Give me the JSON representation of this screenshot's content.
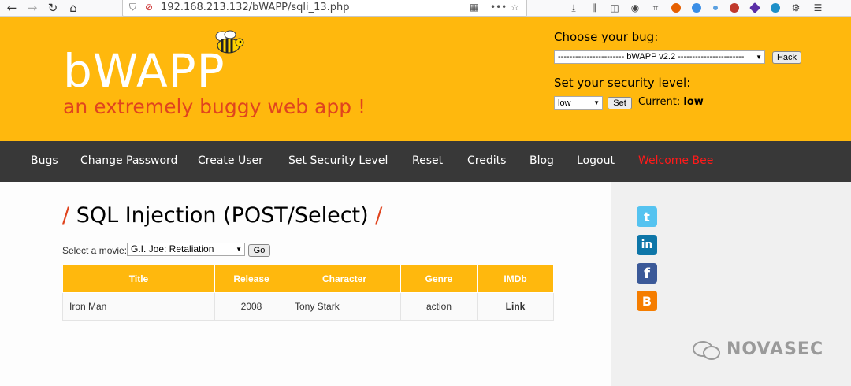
{
  "browser": {
    "url": "192.168.213.132/bWAPP/sqli_13.php"
  },
  "header": {
    "logo": "bWAPP",
    "tagline": "an extremely buggy web app !",
    "choose_bug_label": "Choose your bug:",
    "bug_select_value": "----------------------- bWAPP v2.2 -----------------------",
    "hack_button": "Hack",
    "security_label": "Set your security level:",
    "security_select_value": "low",
    "set_button": "Set",
    "current_label": "Current:",
    "current_value": "low"
  },
  "nav": {
    "items": [
      "Bugs",
      "Change Password",
      "Create User",
      "Set Security Level",
      "Reset",
      "Credits",
      "Blog",
      "Logout",
      "Welcome Bee"
    ]
  },
  "main": {
    "title": "SQL Injection (POST/Select)",
    "title_slash_left": "/",
    "title_slash_right": "/",
    "movie_label": "Select a movie:",
    "movie_select_value": "G.I. Joe: Retaliation",
    "go_button": "Go",
    "table": {
      "headers": [
        "Title",
        "Release",
        "Character",
        "Genre",
        "IMDb"
      ],
      "rows": [
        [
          "Iron Man",
          "2008",
          "Tony Stark",
          "action",
          "Link"
        ]
      ]
    }
  },
  "social": [
    "twitter-icon",
    "linkedin-icon",
    "facebook-icon",
    "blogger-icon"
  ],
  "watermark": "NOVASEC",
  "colors": {
    "header": "#ffb80d",
    "nav": "#383838",
    "accent": "#e0441e",
    "welcome": "#ff1a1a"
  }
}
